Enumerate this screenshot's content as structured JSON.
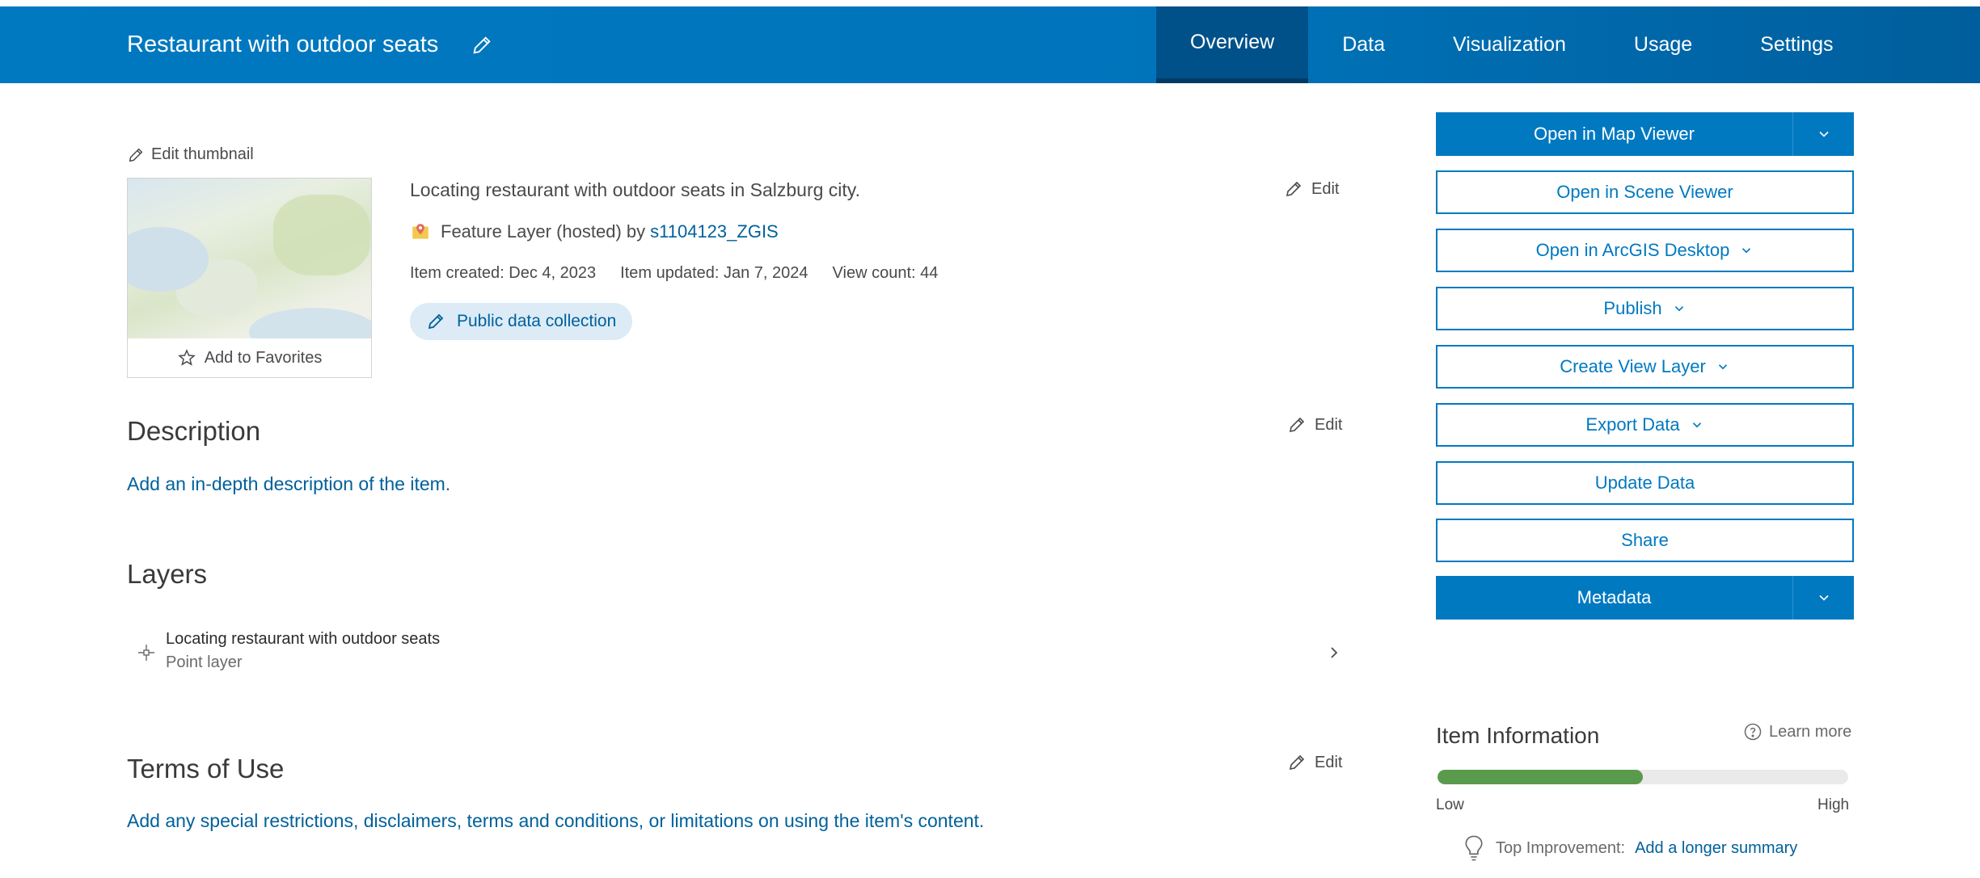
{
  "header": {
    "title": "Restaurant with outdoor seats",
    "tabs": [
      "Overview",
      "Data",
      "Visualization",
      "Usage",
      "Settings"
    ],
    "active_tab": "Overview"
  },
  "thumbnail": {
    "edit_label": "Edit thumbnail",
    "favorites_label": "Add to Favorites"
  },
  "item": {
    "summary": "Locating restaurant with outdoor seats in Salzburg city.",
    "type_text": "Feature Layer (hosted) by",
    "owner": "s1104123_ZGIS",
    "created": "Item created: Dec 4, 2023",
    "updated": "Item updated: Jan 7, 2024",
    "views": "View count: 44",
    "chip": "Public data collection",
    "edit_label": "Edit"
  },
  "description": {
    "heading": "Description",
    "link": "Add an in-depth description of the item.",
    "edit_label": "Edit"
  },
  "layers": {
    "heading": "Layers",
    "items": [
      {
        "name": "Locating restaurant with outdoor seats",
        "type": "Point layer"
      }
    ]
  },
  "terms": {
    "heading": "Terms of Use",
    "link": "Add any special restrictions, disclaimers, terms and conditions, or limitations on using the item's content.",
    "edit_label": "Edit"
  },
  "actions": {
    "open_map_viewer": "Open in Map Viewer",
    "open_scene_viewer": "Open in Scene Viewer",
    "open_arcgis_desktop": "Open in ArcGIS Desktop",
    "publish": "Publish",
    "create_view_layer": "Create View Layer",
    "export_data": "Export Data",
    "update_data": "Update Data",
    "share": "Share",
    "metadata": "Metadata"
  },
  "item_information": {
    "heading": "Item Information",
    "learn_more": "Learn more",
    "progress": 0.5,
    "low": "Low",
    "high": "High",
    "top_improvement_label": "Top Improvement:",
    "top_improvement_link": "Add a longer summary"
  },
  "colors": {
    "brand": "#0079c1",
    "link": "#00619b",
    "progress": "#5a9a4c"
  }
}
